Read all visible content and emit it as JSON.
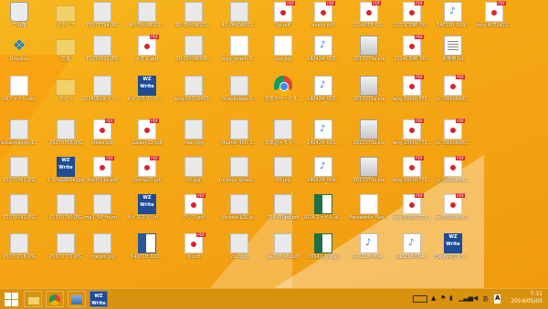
{
  "desktop": {
    "icons": [
      {
        "label": "ごみ箱",
        "type": "recycle",
        "col": 0,
        "row": 0
      },
      {
        "label": "Dropbox",
        "type": "dropbox",
        "col": 0,
        "row": 1
      },
      {
        "label": "UXファイル.doc",
        "type": "white",
        "col": 0,
        "row": 2
      },
      {
        "label": "fantasmagory1.jpg",
        "type": "jpg",
        "col": 0,
        "row": 3
      },
      {
        "label": "P1070761.JPG",
        "type": "jpg",
        "col": 0,
        "row": 4
      },
      {
        "label": "P1070741.JPG",
        "type": "jpg",
        "col": 0,
        "row": 5
      },
      {
        "label": "P1070716.JPG",
        "type": "jpg",
        "col": 0,
        "row": 6
      },
      {
        "label": "ガネーズ",
        "type": "folder",
        "col": 1,
        "row": 0
      },
      {
        "label": "文書",
        "type": "folder",
        "col": 1,
        "row": 1
      },
      {
        "label": "ドイツ",
        "type": "folder",
        "col": 1,
        "row": 2
      },
      {
        "label": "P1070766.JPG",
        "type": "jpg",
        "col": 1,
        "row": 3
      },
      {
        "label": "1.7m@800x.jpg",
        "type": "wzw",
        "col": 1,
        "row": 4
      },
      {
        "label": "P1070790.JPG",
        "type": "jpg",
        "col": 1,
        "row": 5
      },
      {
        "label": "P1070771.JPG",
        "type": "jpg",
        "col": 1,
        "row": 6
      },
      {
        "label": "P5077794.JPG",
        "type": "jpg",
        "col": 2,
        "row": 0
      },
      {
        "label": "P1077920.JPG",
        "type": "jpg",
        "col": 2,
        "row": 1
      },
      {
        "label": "20140518-ドイツ...",
        "type": "jpg",
        "col": 2,
        "row": 2
      },
      {
        "label": "crows.pdf",
        "type": "pdf",
        "col": 2,
        "row": 3
      },
      {
        "label": "jhg0011a.pdf",
        "type": "pdf",
        "col": 2,
        "row": 4
      },
      {
        "label": "img1_50_thum...",
        "type": "jpg",
        "col": 2,
        "row": 5
      },
      {
        "label": "images.jpg",
        "type": "jpg",
        "col": 2,
        "row": 6
      },
      {
        "label": "40_DH-08001...",
        "type": "jpg",
        "col": 3,
        "row": 0
      },
      {
        "label": "大丈夫.pdf",
        "type": "pdf",
        "col": 3,
        "row": 1
      },
      {
        "label": "セイスカリンガル...",
        "type": "wzw",
        "col": 3,
        "row": 2
      },
      {
        "label": "Galaxy32.pdf",
        "type": "pdf",
        "col": 3,
        "row": 3
      },
      {
        "label": "Xperia27.pdf",
        "type": "pdf",
        "col": 3,
        "row": 4
      },
      {
        "label": "セイスカリンガル...",
        "type": "wzw",
        "col": 3,
        "row": 5
      },
      {
        "label": "140718_002...",
        "type": "doc",
        "col": 3,
        "row": 6
      },
      {
        "label": "02_DH-08001...",
        "type": "jpg",
        "col": 4,
        "row": 0
      },
      {
        "label": "30_DH-08000...",
        "type": "jpg",
        "col": 4,
        "row": 1
      },
      {
        "label": "leng-00718470...",
        "type": "jpg",
        "col": 4,
        "row": 2
      },
      {
        "label": "main.jpg",
        "type": "jpg",
        "col": 4,
        "row": 3
      },
      {
        "label": "s5.jpg",
        "type": "jpg",
        "col": 4,
        "row": 4
      },
      {
        "label": "グリフ.pdf",
        "type": "pdf",
        "col": 4,
        "row": 5
      },
      {
        "label": "XI.pdf",
        "type": "pdf",
        "col": 4,
        "row": 6
      },
      {
        "label": "40_DH-08001...",
        "type": "jpg",
        "col": 5,
        "row": 0
      },
      {
        "label": "leng_graph_1...",
        "type": "white",
        "col": 5,
        "row": 1
      },
      {
        "label": "SnapImage-0...",
        "type": "jpg",
        "col": 5,
        "row": 2
      },
      {
        "label": "thumb_450_1...",
        "type": "jpg",
        "col": 5,
        "row": 3
      },
      {
        "label": "tuckeys_gmail.pdf",
        "type": "jpg",
        "col": 5,
        "row": 4
      },
      {
        "label": "Various-LOL-p...",
        "type": "jpg",
        "col": 5,
        "row": 5
      },
      {
        "label": "cx2.jpg",
        "type": "jpg",
        "col": 5,
        "row": 6
      },
      {
        "label": "ljp.pdf",
        "type": "pdf",
        "col": 6,
        "row": 0
      },
      {
        "label": "xxx.jpg",
        "type": "white",
        "col": 6,
        "row": 1
      },
      {
        "label": "日本のサービス...",
        "type": "chrome",
        "col": 6,
        "row": 2
      },
      {
        "label": "日本語メモリー...",
        "type": "jpg",
        "col": 6,
        "row": 3
      },
      {
        "label": "20.jpg",
        "type": "jpg",
        "col": 6,
        "row": 4
      },
      {
        "label": "706_00jpg.pdf",
        "type": "jpg",
        "col": 6,
        "row": 5
      },
      {
        "label": "aa000_xls.pdf",
        "type": "jpg",
        "col": 6,
        "row": 6
      },
      {
        "label": "xxxxx.pdf",
        "type": "pdf",
        "col": 7,
        "row": 0
      },
      {
        "label": "140424_003...",
        "type": "mp3",
        "col": 7,
        "row": 1
      },
      {
        "label": "140424_003...",
        "type": "mp3",
        "col": 7,
        "row": 2
      },
      {
        "label": "140424_003...",
        "type": "mp3",
        "col": 7,
        "row": 3
      },
      {
        "label": "140424_004...",
        "type": "mp3",
        "col": 7,
        "row": 4
      },
      {
        "label": "2014ファイル.xlsx",
        "type": "xls",
        "col": 7,
        "row": 5
      },
      {
        "label": "2014入金.xlsx",
        "type": "xls",
        "col": 7,
        "row": 6
      },
      {
        "label": "2014033_00...",
        "type": "pdf",
        "col": 8,
        "row": 0
      },
      {
        "label": "2013070a.sfx",
        "type": "sfx",
        "col": 8,
        "row": 1
      },
      {
        "label": "2013071a.sfx",
        "type": "sfx",
        "col": 8,
        "row": 2
      },
      {
        "label": "2013070a.sfx",
        "type": "sfx",
        "col": 8,
        "row": 3
      },
      {
        "label": "2013070a.sfx",
        "type": "sfx",
        "col": 8,
        "row": 4
      },
      {
        "label": "Facewerks_Nex...",
        "type": "white",
        "col": 8,
        "row": 5
      },
      {
        "label": "140218_004...",
        "type": "mp3",
        "col": 8,
        "row": 6
      },
      {
        "label": "2013C398_00...",
        "type": "pdf",
        "col": 9,
        "row": 0
      },
      {
        "label": "2014C398_00...",
        "type": "pdf",
        "col": 9,
        "row": 1
      },
      {
        "label": "leng-20000775...",
        "type": "pdf",
        "col": 9,
        "row": 2
      },
      {
        "label": "leng-20000775...",
        "type": "pdf",
        "col": 9,
        "row": 3
      },
      {
        "label": "leng-20000775...",
        "type": "pdf",
        "col": 9,
        "row": 4
      },
      {
        "label": "leng-20000775...",
        "type": "pdf",
        "col": 9,
        "row": 5
      },
      {
        "label": "140218_004...",
        "type": "mp3",
        "col": 9,
        "row": 6
      },
      {
        "label": "140130_009...",
        "type": "mp3",
        "col": 10,
        "row": 0
      },
      {
        "label": "出身地.txt",
        "type": "txt",
        "col": 10,
        "row": 1
      },
      {
        "label": "cc_DB6066f0...",
        "type": "pdf",
        "col": 10,
        "row": 2
      },
      {
        "label": "cc_DB6066f0...",
        "type": "pdf",
        "col": 10,
        "row": 3
      },
      {
        "label": "cc_DB6066f0...",
        "type": "pdf",
        "col": 10,
        "row": 4
      },
      {
        "label": "cc_DB6066f0...",
        "type": "pdf",
        "col": 10,
        "row": 5
      },
      {
        "label": "北海道共同スクール.txt",
        "type": "wzw",
        "col": 10,
        "row": 6
      },
      {
        "label": "leng-4071421...",
        "type": "pdf",
        "col": 11,
        "row": 0
      }
    ]
  },
  "taskbar": {
    "pinned": [
      {
        "name": "file-explorer-button",
        "icon": "folder-icon"
      },
      {
        "name": "chrome-button",
        "icon": "chrome-icon"
      },
      {
        "name": "photos-button",
        "icon": "photos-icon"
      },
      {
        "name": "wzwriter-button",
        "icon": "wzwriter-icon"
      }
    ],
    "clock_time": "7:11",
    "clock_date": "2014/05/03",
    "ime_label": "A"
  }
}
